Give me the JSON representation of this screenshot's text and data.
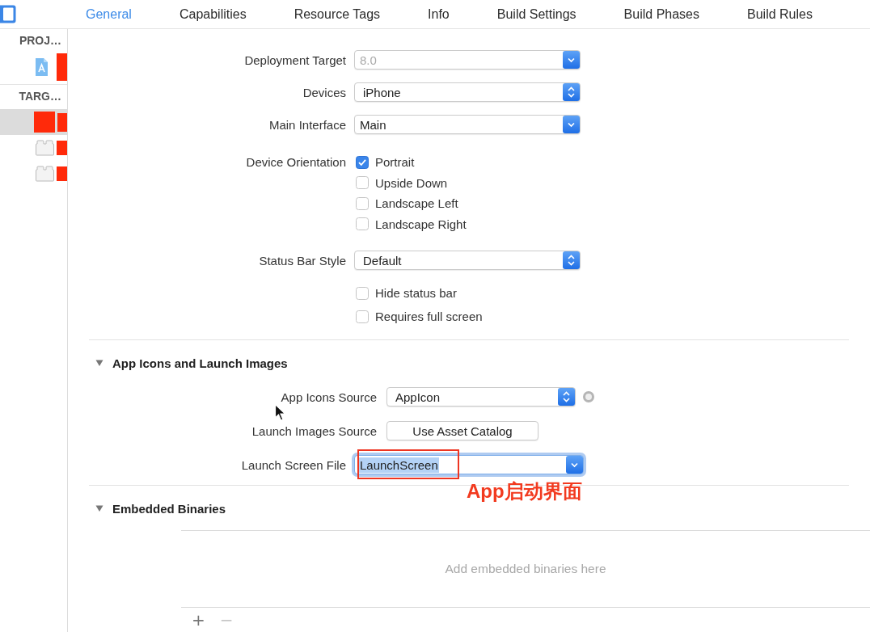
{
  "toolbar": {
    "tabs": [
      {
        "label": "General",
        "selected": true
      },
      {
        "label": "Capabilities",
        "selected": false
      },
      {
        "label": "Resource Tags",
        "selected": false
      },
      {
        "label": "Info",
        "selected": false
      },
      {
        "label": "Build Settings",
        "selected": false
      },
      {
        "label": "Build Phases",
        "selected": false
      },
      {
        "label": "Build Rules",
        "selected": false
      }
    ]
  },
  "sidebar": {
    "groups": [
      {
        "header": "PROJ…",
        "items": [
          {
            "kind": "app-file",
            "selected": false
          }
        ]
      },
      {
        "header": "TARG…",
        "items": [
          {
            "kind": "redacted",
            "selected": true
          },
          {
            "kind": "target",
            "selected": false
          },
          {
            "kind": "target",
            "selected": false
          }
        ]
      }
    ]
  },
  "deployment_info": {
    "rows": [
      {
        "kind": "combo",
        "label": "Deployment Target",
        "placeholder": "8.0"
      },
      {
        "kind": "popup",
        "label": "Devices",
        "value": "iPhone"
      },
      {
        "kind": "combo",
        "label": "Main Interface",
        "value": "Main"
      },
      {
        "kind": "checkboxes",
        "label": "Device Orientation",
        "options": [
          {
            "label": "Portrait",
            "checked": true
          },
          {
            "label": "Upside Down",
            "checked": false
          },
          {
            "label": "Landscape Left",
            "checked": false
          },
          {
            "label": "Landscape Right",
            "checked": false
          }
        ]
      },
      {
        "kind": "popup",
        "label": "Status Bar Style",
        "value": "Default"
      },
      {
        "kind": "checkboxes",
        "options": [
          {
            "label": "Hide status bar",
            "checked": false
          },
          {
            "label": "Requires full screen",
            "checked": false
          }
        ]
      }
    ]
  },
  "sections": [
    {
      "title": "App Icons and Launch Images",
      "expanded": true,
      "rows": [
        {
          "kind": "popup",
          "label": "App Icons Source",
          "value": "AppIcon"
        },
        {
          "kind": "button",
          "label": "Launch Images Source",
          "value": "Use Asset Catalog"
        },
        {
          "kind": "combo",
          "label": "Launch Screen File",
          "value": "LaunchScreen",
          "focused": true,
          "text_selected": true,
          "annotation": "App启动界面"
        }
      ]
    },
    {
      "title": "Embedded Binaries",
      "expanded": true,
      "table": {
        "placeholder": "Add embedded binaries here",
        "buttons": [
          {
            "label": "+",
            "disabled": false
          },
          {
            "label": "−",
            "disabled": true
          }
        ]
      }
    }
  ]
}
